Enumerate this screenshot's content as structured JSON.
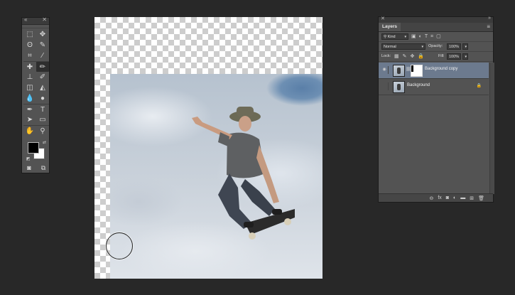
{
  "tools_panel": {
    "collapse_glyph": "«",
    "close_glyph": "✕",
    "tools": [
      {
        "name": "rectangular-marquee-icon",
        "glyph": "⬚"
      },
      {
        "name": "move-icon",
        "glyph": "✥"
      },
      {
        "name": "lasso-icon",
        "glyph": "ʘ"
      },
      {
        "name": "quick-selection-icon",
        "glyph": "✎"
      },
      {
        "name": "crop-icon",
        "glyph": "⌗"
      },
      {
        "name": "eyedropper-icon",
        "glyph": "⁄"
      },
      {
        "name": "spot-healing-icon",
        "glyph": "✚"
      },
      {
        "name": "brush-icon",
        "glyph": "✏"
      },
      {
        "name": "clone-stamp-icon",
        "glyph": "⊥"
      },
      {
        "name": "history-brush-icon",
        "glyph": "✐"
      },
      {
        "name": "eraser-icon",
        "glyph": "◫"
      },
      {
        "name": "paint-bucket-icon",
        "glyph": "◭"
      },
      {
        "name": "blur-icon",
        "glyph": "💧"
      },
      {
        "name": "dodge-icon",
        "glyph": "●"
      },
      {
        "name": "pen-icon",
        "glyph": "✒"
      },
      {
        "name": "type-icon",
        "glyph": "T"
      },
      {
        "name": "path-selection-icon",
        "glyph": "➤"
      },
      {
        "name": "rectangle-shape-icon",
        "glyph": "▭"
      },
      {
        "name": "hand-icon",
        "glyph": "✋"
      },
      {
        "name": "zoom-icon",
        "glyph": "⚲"
      }
    ],
    "swap_glyph": "⇄",
    "default_glyph": "◩",
    "quick_mask_glyph": "◙",
    "screen_mode_glyph": "⧉"
  },
  "layers_panel": {
    "close_glyph": "✕",
    "collapse_glyph": "»",
    "tab_label": "Layers",
    "menu_glyph": "≡",
    "filter": {
      "kind_label": "Kind",
      "icons": [
        "▣",
        "◐",
        "T",
        "⌗",
        "▢"
      ]
    },
    "blend_mode": "Normal",
    "opacity_label": "Opacity:",
    "opacity_value": "100%",
    "lock_label": "Lock:",
    "lock_icons": [
      "▦",
      "✎",
      "✥",
      "🔒"
    ],
    "fill_label": "Fill:",
    "fill_value": "100%",
    "layers": [
      {
        "name": "Background copy",
        "visible": true,
        "selected": true,
        "has_mask": true
      },
      {
        "name": "Background",
        "visible": false,
        "selected": false,
        "locked": true
      }
    ],
    "eye_glyph": "◉",
    "chain_glyph": "⛓",
    "lock_glyph": "🔒",
    "bottom_icons": [
      {
        "name": "link-layers-icon",
        "glyph": "⊖"
      },
      {
        "name": "fx-icon",
        "glyph": "fx"
      },
      {
        "name": "add-mask-icon",
        "glyph": "◙"
      },
      {
        "name": "adjustment-icon",
        "glyph": "◐"
      },
      {
        "name": "group-icon",
        "glyph": "▬"
      },
      {
        "name": "new-layer-icon",
        "glyph": "⊞"
      },
      {
        "name": "trash-icon",
        "glyph": "🗑"
      }
    ]
  }
}
